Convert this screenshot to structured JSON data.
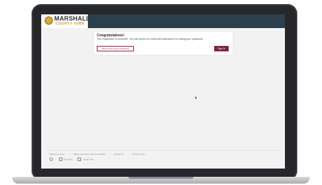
{
  "header": {
    "logo_main": "MARSHALL",
    "logo_sub": "COUNTY IOWA"
  },
  "notice": {
    "title": "Congratulations!",
    "message": "Your registration is complete. You will receive an email with instructions for setting your password.",
    "resend_label": "Resend Temporary Password",
    "signin_label": "Sign In"
  },
  "footer": {
    "links": [
      "Digital Inclusivity",
      "Digital Information and Accessibility",
      "Disclaimer",
      "Privacy Policy"
    ],
    "app_store": "App Store",
    "google_play": "Google Play"
  },
  "colors": {
    "topbar": "#2c3f4c",
    "accent": "#7b2346",
    "logo_gold": "#c9982c"
  }
}
